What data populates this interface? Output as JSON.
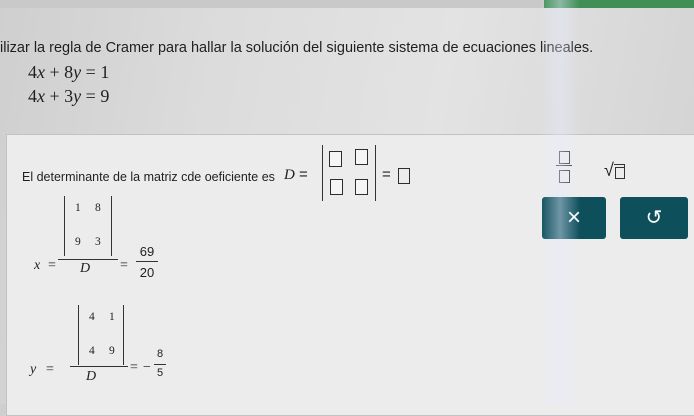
{
  "problem": {
    "prompt": "ilizar la regla de Cramer para hallar la solución del siguiente sistema de ecuaciones lineales.",
    "equations": [
      {
        "a": "4",
        "x": "x",
        "op": "+",
        "b": "8",
        "y": "y",
        "eq": "=",
        "c": "1"
      },
      {
        "a": "4",
        "x": "x",
        "op": "+",
        "b": "3",
        "y": "y",
        "eq": "=",
        "c": "9"
      }
    ]
  },
  "determinant": {
    "text": "El determinante de la matriz cde oeficiente es",
    "label": "D",
    "equals1": "=",
    "equals2": "="
  },
  "toolbar": {
    "fraction_icon": "fraction-icon",
    "sqrt_symbol": "√",
    "clear_label": "×",
    "undo_label": "↺"
  },
  "x_solution": {
    "label": "x",
    "equals": "=",
    "matrix": [
      "1",
      "8",
      "9",
      "3"
    ],
    "denominator": "D",
    "equals2": "=",
    "numerator": "69",
    "denom_value": "20"
  },
  "y_solution": {
    "label": "y",
    "equals": "=",
    "matrix": [
      "4",
      "1",
      "4",
      "9"
    ],
    "denominator": "D",
    "equals2": "=",
    "sign": "−",
    "numerator": "8",
    "denom_value": "5"
  }
}
